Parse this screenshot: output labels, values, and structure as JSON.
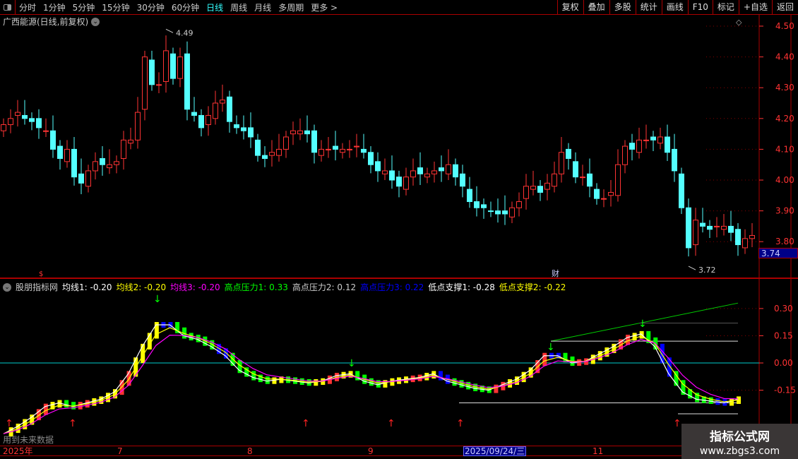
{
  "toolbar": {
    "periods": [
      "分时",
      "1分钟",
      "5分钟",
      "15分钟",
      "30分钟",
      "60分钟",
      "日线",
      "周线",
      "月线",
      "多周期",
      "更多 >"
    ],
    "active_period": "日线",
    "buttons": [
      "复权",
      "叠加",
      "多股",
      "统计",
      "画线",
      "F10",
      "标记",
      "+自选",
      "返回"
    ]
  },
  "stock": {
    "title": "广西能源(日线,前复权)",
    "current_price": "3.74",
    "high_label": "4.49",
    "low_label": "3.72",
    "marker_cai": "财",
    "marker_s": "$"
  },
  "indicator": {
    "name": "股朋指标网",
    "legend": [
      {
        "text": "均线1: -0.20",
        "color": "#ffffff"
      },
      {
        "text": "均线2: -0.20",
        "color": "#ffff00"
      },
      {
        "text": "均线3: -0.20",
        "color": "#ff00ff"
      },
      {
        "text": "高点压力1: 0.33",
        "color": "#00ff00"
      },
      {
        "text": "高点压力2: 0.12",
        "color": "#cccccc"
      },
      {
        "text": "高点压力3: 0.22",
        "color": "#0000ff"
      },
      {
        "text": "低点支撑1: -0.28",
        "color": "#ffffff"
      },
      {
        "text": "低点支撑2: -0.22",
        "color": "#ffff00"
      }
    ],
    "future_note": "用到未来数据"
  },
  "xaxis": {
    "labels": [
      "2025年",
      "7",
      "8",
      "9",
      "11"
    ],
    "selected_date": "2025/09/24/三"
  },
  "watermark": {
    "line1": "指标公式网",
    "line2": "www.zbgs3.com"
  },
  "colors": {
    "up": "#ff3333",
    "down": "#54ffff",
    "axis": "#ff3333",
    "border": "#aa0000"
  },
  "chart_data": [
    {
      "type": "candlestick",
      "title": "广西能源(日线,前复权)",
      "ylim": [
        3.66,
        4.52
      ],
      "yticks": [
        4.5,
        4.4,
        4.3,
        4.2,
        4.1,
        4.0,
        3.9,
        3.8
      ],
      "closes": [
        4.18,
        4.2,
        4.22,
        4.2,
        4.19,
        4.17,
        4.16,
        4.1,
        4.07,
        4.1,
        4.01,
        3.99,
        4.03,
        4.06,
        4.05,
        4.05,
        4.06,
        4.13,
        4.13,
        4.22,
        4.4,
        4.31,
        4.31,
        4.42,
        4.33,
        4.4,
        4.23,
        4.21,
        4.17,
        4.21,
        4.25,
        4.26,
        4.19,
        4.17,
        4.16,
        4.14,
        4.08,
        4.07,
        4.09,
        4.1,
        4.14,
        4.16,
        4.16,
        4.15,
        4.09,
        4.1,
        4.1,
        4.1,
        4.1,
        4.1,
        4.11,
        4.09,
        4.05,
        4.03,
        4.03,
        4.0,
        3.98,
        4.01,
        4.03,
        4.02,
        4.02,
        4.03,
        4.03,
        4.05,
        4.01,
        3.98,
        3.93,
        3.91,
        3.91,
        3.9,
        3.89,
        3.89,
        3.91,
        3.93,
        3.98,
        3.98,
        3.96,
        3.99,
        4.02,
        4.09,
        4.07,
        4.01,
        4.01,
        3.98,
        3.94,
        3.94,
        3.96,
        4.05,
        4.11,
        4.1,
        4.13,
        4.13,
        4.13,
        4.14,
        4.09,
        4.03,
        3.91,
        3.78,
        3.87,
        3.85,
        3.84,
        3.85,
        3.85,
        3.83,
        3.79,
        3.81,
        3.82
      ],
      "high": 4.49,
      "low": 3.72
    },
    {
      "type": "line",
      "title": "股朋指标网",
      "ylim": [
        -0.42,
        0.42
      ],
      "yticks": [
        0.3,
        0.15,
        0.0,
        -0.15
      ],
      "ma1": [
        -0.39,
        -0.35,
        -0.3,
        -0.24,
        -0.22,
        -0.24,
        -0.22,
        -0.2,
        -0.16,
        -0.06,
        0.09,
        0.21,
        0.21,
        0.15,
        0.13,
        0.09,
        0.04,
        -0.04,
        -0.08,
        -0.1,
        -0.09,
        -0.1,
        -0.11,
        -0.1,
        -0.07,
        -0.06,
        -0.1,
        -0.12,
        -0.1,
        -0.09,
        -0.08,
        -0.06,
        -0.1,
        -0.12,
        -0.14,
        -0.15,
        -0.12,
        -0.09,
        -0.04,
        0.04,
        0.04,
        0.0,
        0.01,
        0.05,
        0.09,
        0.14,
        0.16,
        0.09,
        -0.06,
        -0.16,
        -0.2,
        -0.21,
        -0.22,
        -0.2
      ],
      "zero_line": 0.0,
      "resistance1": [
        0.12,
        0.33
      ],
      "resistance2": 0.12,
      "resistance3": 0.22,
      "support1": -0.28,
      "support2": -0.22
    }
  ]
}
